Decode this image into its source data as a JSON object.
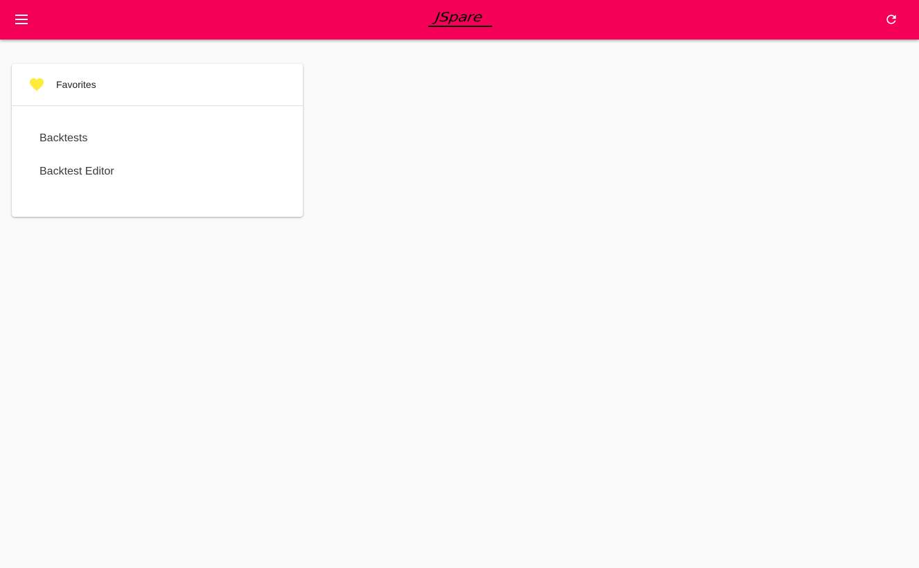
{
  "toolbar": {
    "background_color": "#f50057",
    "menu_icon": "menu-icon",
    "refresh_icon": "refresh-icon",
    "logo_text": "JSpare"
  },
  "favorites_card": {
    "title": "Favorites",
    "icon": "heart-icon",
    "icon_color": "#ffeb3b",
    "items": [
      {
        "label": "Backtests"
      },
      {
        "label": "Backtest Editor"
      }
    ]
  }
}
